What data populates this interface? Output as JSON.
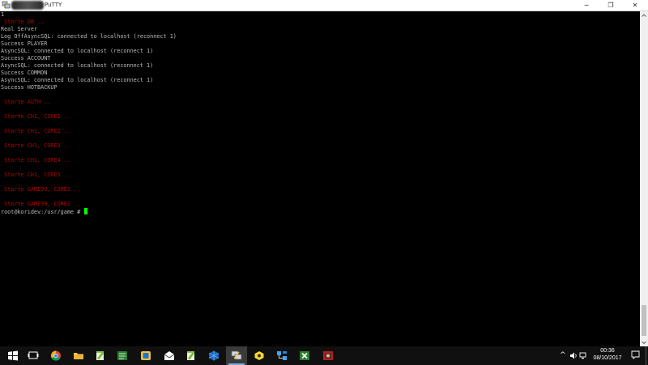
{
  "window": {
    "title": "PuTTY",
    "controls": {
      "minimize": "─",
      "maximize": "❐",
      "close": "✕"
    }
  },
  "terminal": {
    "lines": [
      {
        "text": "1",
        "color": "gray"
      },
      {
        "text": " Starte DB ..",
        "color": "red"
      },
      {
        "text": "Real Server",
        "color": "gray"
      },
      {
        "text": "Log OffAsyncSQL: connected to localhost (reconnect 1)",
        "color": "gray"
      },
      {
        "text": "Success PLAYER",
        "color": "gray"
      },
      {
        "text": "AsyncSQL: connected to localhost (reconnect 1)",
        "color": "gray"
      },
      {
        "text": "Success ACCOUNT",
        "color": "gray"
      },
      {
        "text": "AsyncSQL: connected to localhost (reconnect 1)",
        "color": "gray"
      },
      {
        "text": "Success COMMON",
        "color": "gray"
      },
      {
        "text": "AsyncSQL: connected to localhost (reconnect 1)",
        "color": "gray"
      },
      {
        "text": "Success HOTBACKUP",
        "color": "gray"
      },
      {
        "text": "",
        "color": "gray"
      },
      {
        "text": " Starte AUTH ..",
        "color": "red"
      },
      {
        "text": "",
        "color": "gray"
      },
      {
        "text": " Starte CH1, CORE1 ..",
        "color": "red"
      },
      {
        "text": "",
        "color": "gray"
      },
      {
        "text": " Starte CH1, CORE2 ..",
        "color": "red"
      },
      {
        "text": "",
        "color": "gray"
      },
      {
        "text": " Starte CH1, CORE3 ..",
        "color": "red"
      },
      {
        "text": "",
        "color": "gray"
      },
      {
        "text": " Starte CH1, CORE4 ..",
        "color": "red"
      },
      {
        "text": "",
        "color": "gray"
      },
      {
        "text": " Starte CH1, CORE5 ..",
        "color": "red"
      },
      {
        "text": "",
        "color": "gray"
      },
      {
        "text": " Starte GAME99, CORE1 ..",
        "color": "red"
      },
      {
        "text": "",
        "color": "gray"
      },
      {
        "text": " Starte GAME99, CORE2 ..",
        "color": "red"
      }
    ],
    "prompt": "root@koridev:/usr/game # "
  },
  "taskbar": {
    "apps": [
      {
        "name": "start-button",
        "icon": "windows-logo-icon",
        "active": false
      },
      {
        "name": "task-view-button",
        "icon": "task-view-icon",
        "active": false
      },
      {
        "name": "chrome-button",
        "icon": "chrome-icon",
        "active": false
      },
      {
        "name": "file-explorer-button",
        "icon": "folder-icon",
        "active": false
      },
      {
        "name": "notepadpp-button",
        "icon": "notepad-plus-plus-icon",
        "active": false
      },
      {
        "name": "navicat-button",
        "icon": "database-icon",
        "active": false
      },
      {
        "name": "winscp-button",
        "icon": "transfer-icon",
        "active": false
      },
      {
        "name": "mail-button",
        "icon": "mail-icon",
        "active": false
      },
      {
        "name": "notepadpp2-button",
        "icon": "notepad-plus-plus-icon",
        "active": false
      },
      {
        "name": "virtualbox-button",
        "icon": "virtualbox-icon",
        "active": false
      },
      {
        "name": "putty-button",
        "icon": "putty-icon",
        "active": true
      },
      {
        "name": "app-yellow-button",
        "icon": "hexagon-icon",
        "active": false
      },
      {
        "name": "network-app-button",
        "icon": "network-icon",
        "active": false
      },
      {
        "name": "excel-button",
        "icon": "spreadsheet-icon",
        "active": false
      },
      {
        "name": "red-app-button",
        "icon": "game-icon",
        "active": false
      }
    ],
    "tray": {
      "chevron": "^",
      "time": "00:36",
      "date": "08/10/2017"
    },
    "colors": {
      "accent": "#7aa7d8",
      "background": "#101010"
    }
  },
  "colors": {
    "text_gray": "#bbbbbb",
    "text_red": "#b80000",
    "cursor": "#00ff00"
  }
}
